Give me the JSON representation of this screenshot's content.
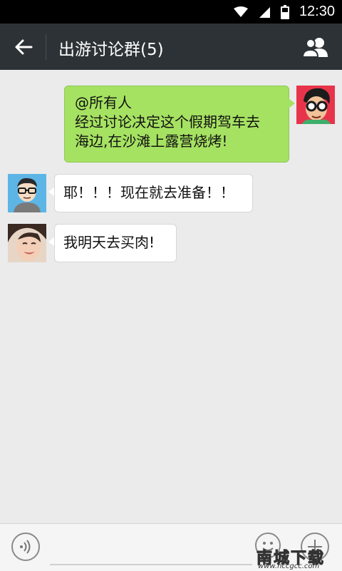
{
  "status_bar": {
    "time": "12:30"
  },
  "header": {
    "back_icon": "arrow-left-icon",
    "title": "出游讨论群(5)",
    "group_icon": "group-members-icon"
  },
  "messages": [
    {
      "side": "right",
      "sender": "me",
      "lines": [
        "@所有人",
        "经过讨论决定这个假期驾车去",
        "海边,在沙滩上露营烧烤!"
      ]
    },
    {
      "side": "left",
      "sender": "glasses-guy",
      "text": "耶！！！现在就去准备！！"
    },
    {
      "side": "left",
      "sender": "girl",
      "text": "我明天去买肉!"
    }
  ],
  "input_bar": {
    "placeholder": "",
    "voice_icon": "voice-icon",
    "emoji_icon": "emoji-icon",
    "plus_icon": "plus-icon"
  },
  "watermark": {
    "title": "南城下载",
    "url": "www.nccgcc.com"
  },
  "colors": {
    "header_bg": "#2d3236",
    "chat_bg": "#ebebeb",
    "bubble_self": "#a6e262",
    "bubble_other": "#ffffff"
  }
}
